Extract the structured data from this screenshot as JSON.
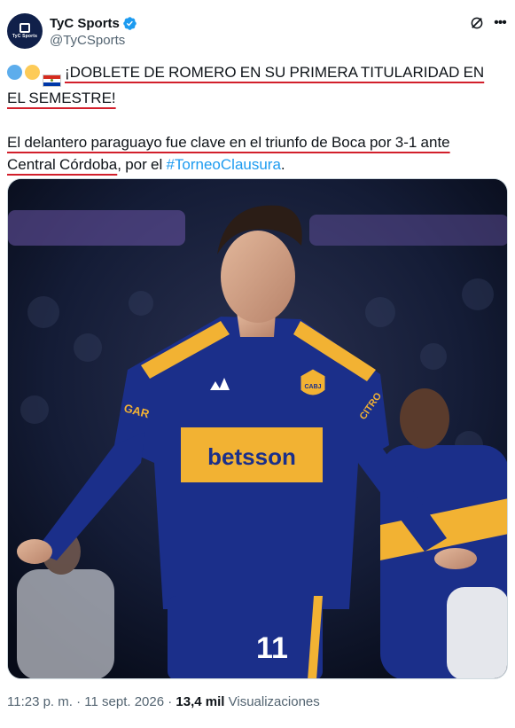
{
  "author": {
    "display_name": "TyC Sports",
    "handle": "@TyCSports",
    "avatar_text": "TyC Sports",
    "verified": true
  },
  "tweet": {
    "headline": "¡DOBLETE DE ROMERO EN SU PRIMERA TITULARIDAD EN EL SEMESTRE!",
    "body_before_link": "El delantero paraguayo fue clave en el triunfo de Boca por 3-1 ante Central Córdoba",
    "body_middle": ", por el ",
    "hashtag": "#TorneoClausura",
    "body_end": ".",
    "emojis": [
      "blue-circle",
      "yellow-circle",
      "paraguay-flag"
    ]
  },
  "media": {
    "jersey_sponsor": "betsson",
    "jersey_number": "11",
    "sleeve_text_left": "GAR",
    "sleeve_text_right": "CITRO",
    "crest_text": "CABJ"
  },
  "meta": {
    "time": "11:23 p. m.",
    "separator": "·",
    "date": "11 sept. 2026",
    "views_count": "13,4 mil",
    "views_label": "Visualizaciones"
  },
  "colors": {
    "verified_blue": "#1d9bf0",
    "underline_red": "#d21f2b",
    "boca_blue": "#1b2f8a",
    "boca_gold": "#f2b233"
  }
}
